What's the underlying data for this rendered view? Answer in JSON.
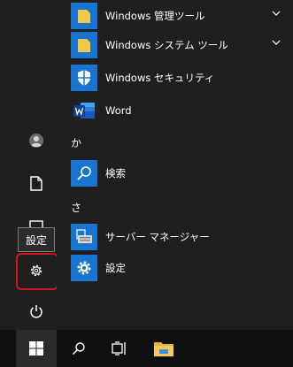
{
  "start_menu": {
    "apps": [
      {
        "label": "Windows 管理ツール",
        "icon": "folder-icon",
        "has_submenu": true
      },
      {
        "label": "Windows システム ツール",
        "icon": "folder-icon",
        "has_submenu": true
      },
      {
        "label": "Windows セキュリティ",
        "icon": "shield-icon",
        "has_submenu": false
      },
      {
        "label": "Word",
        "icon": "word-icon",
        "has_submenu": false
      },
      {
        "label": "検索",
        "icon": "search-icon",
        "has_submenu": false
      },
      {
        "label": "サーバー マネージャー",
        "icon": "server-manager-icon",
        "has_submenu": false
      },
      {
        "label": "設定",
        "icon": "gear-icon",
        "has_submenu": false
      }
    ],
    "section_letters": [
      "か",
      "さ"
    ]
  },
  "rail": {
    "tooltip": "設定",
    "buttons": [
      "user-icon",
      "document-icon",
      "pictures-icon",
      "gear-icon",
      "power-icon"
    ]
  },
  "taskbar": {
    "buttons": [
      "windows-start-icon",
      "search-icon",
      "task-view-icon",
      "file-explorer-icon"
    ]
  },
  "colors": {
    "background": "#1f1f1f",
    "tile_blue": "#1874d1",
    "highlight_red": "#d0151b",
    "taskbar": "#101010"
  }
}
